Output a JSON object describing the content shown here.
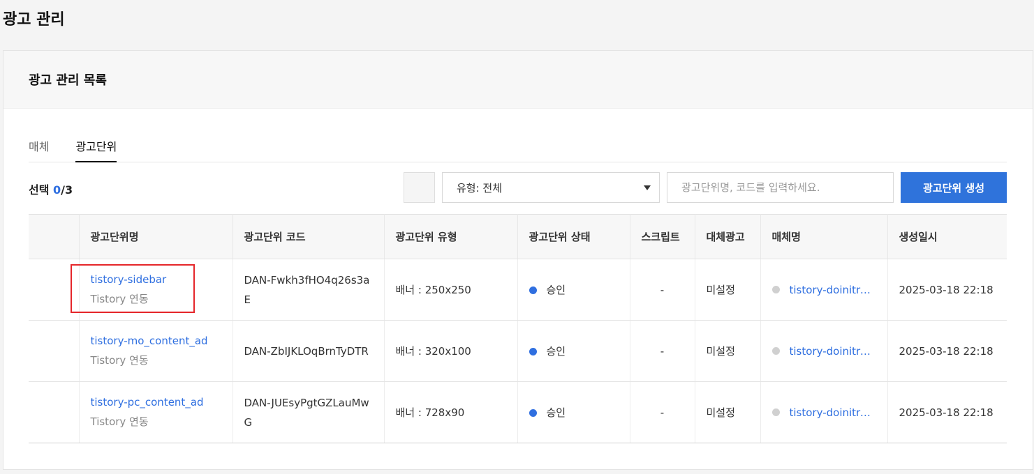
{
  "page": {
    "title": "광고 관리"
  },
  "panel": {
    "title": "광고 관리 목록"
  },
  "tabs": [
    {
      "label": "매체",
      "active": false
    },
    {
      "label": "광고단위",
      "active": true
    }
  ],
  "toolbar": {
    "selection_label": "선택",
    "selected": "0",
    "total": "/3",
    "type_select_value": "유형: 전체",
    "search_placeholder": "광고단위명, 코드를 입력하세요.",
    "create_button": "광고단위 생성"
  },
  "table": {
    "headers": [
      "",
      "광고단위명",
      "광고단위 코드",
      "광고단위 유형",
      "광고단위 상태",
      "스크립트",
      "대체광고",
      "매체명",
      "생성일시"
    ],
    "rows": [
      {
        "name": "tistory-sidebar",
        "sub": "Tistory 연동",
        "code": "DAN-Fwkh3fHO4q26s3aE",
        "type": "배너 : 250x250",
        "status": "승인",
        "script": "-",
        "fallback": "미설정",
        "media": "tistory-doinitrend",
        "created": "2025-03-18 22:18"
      },
      {
        "name": "tistory-mo_content_ad",
        "sub": "Tistory 연동",
        "code": "DAN-ZbIJKLOqBrnTyDTR",
        "type": "배너 : 320x100",
        "status": "승인",
        "script": "-",
        "fallback": "미설정",
        "media": "tistory-doinitrend",
        "created": "2025-03-18 22:18"
      },
      {
        "name": "tistory-pc_content_ad",
        "sub": "Tistory 연동",
        "code": "DAN-JUEsyPgtGZLauMwG",
        "type": "배너 : 728x90",
        "status": "승인",
        "script": "-",
        "fallback": "미설정",
        "media": "tistory-doinitrend",
        "created": "2025-03-18 22:18"
      }
    ]
  },
  "colors": {
    "accent": "#2f73db",
    "link": "#2f6fe0",
    "status_approved": "#2f6fe0",
    "media_dot": "#d0d0d0",
    "highlight": "#e5262a"
  }
}
